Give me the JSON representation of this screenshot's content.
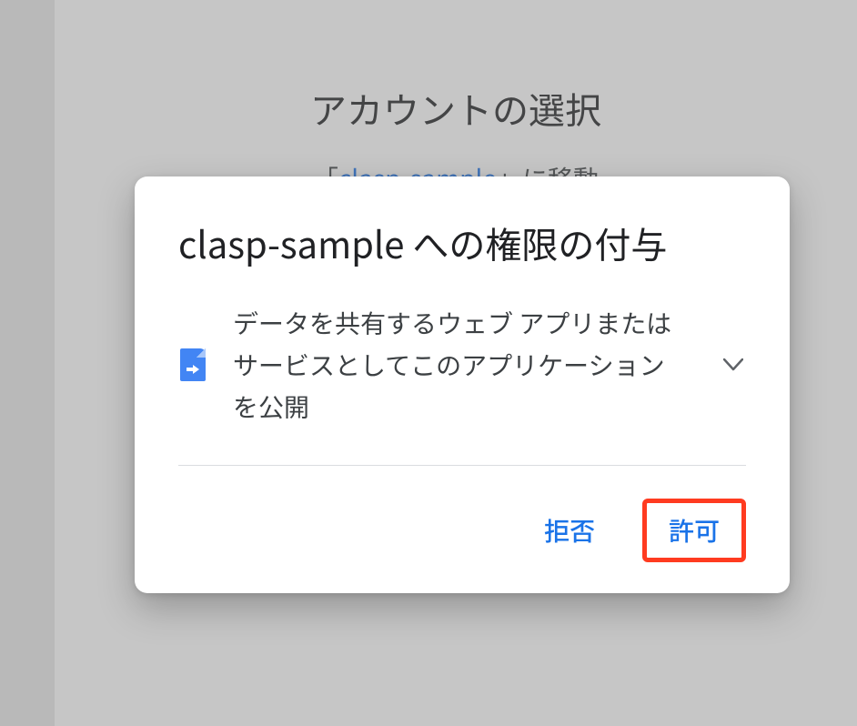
{
  "background": {
    "title": "アカウントの選択",
    "subtitle_prefix": "「",
    "subtitle_link": "clasp-sample",
    "subtitle_suffix": "」に移動"
  },
  "dialog": {
    "title": "clasp-sample への権限の付与",
    "permission": {
      "text": "データを共有するウェブ アプリまたはサービスとしてこのアプリケーションを公開",
      "icon": "file-export-icon"
    },
    "buttons": {
      "deny": "拒否",
      "allow": "許可"
    }
  }
}
